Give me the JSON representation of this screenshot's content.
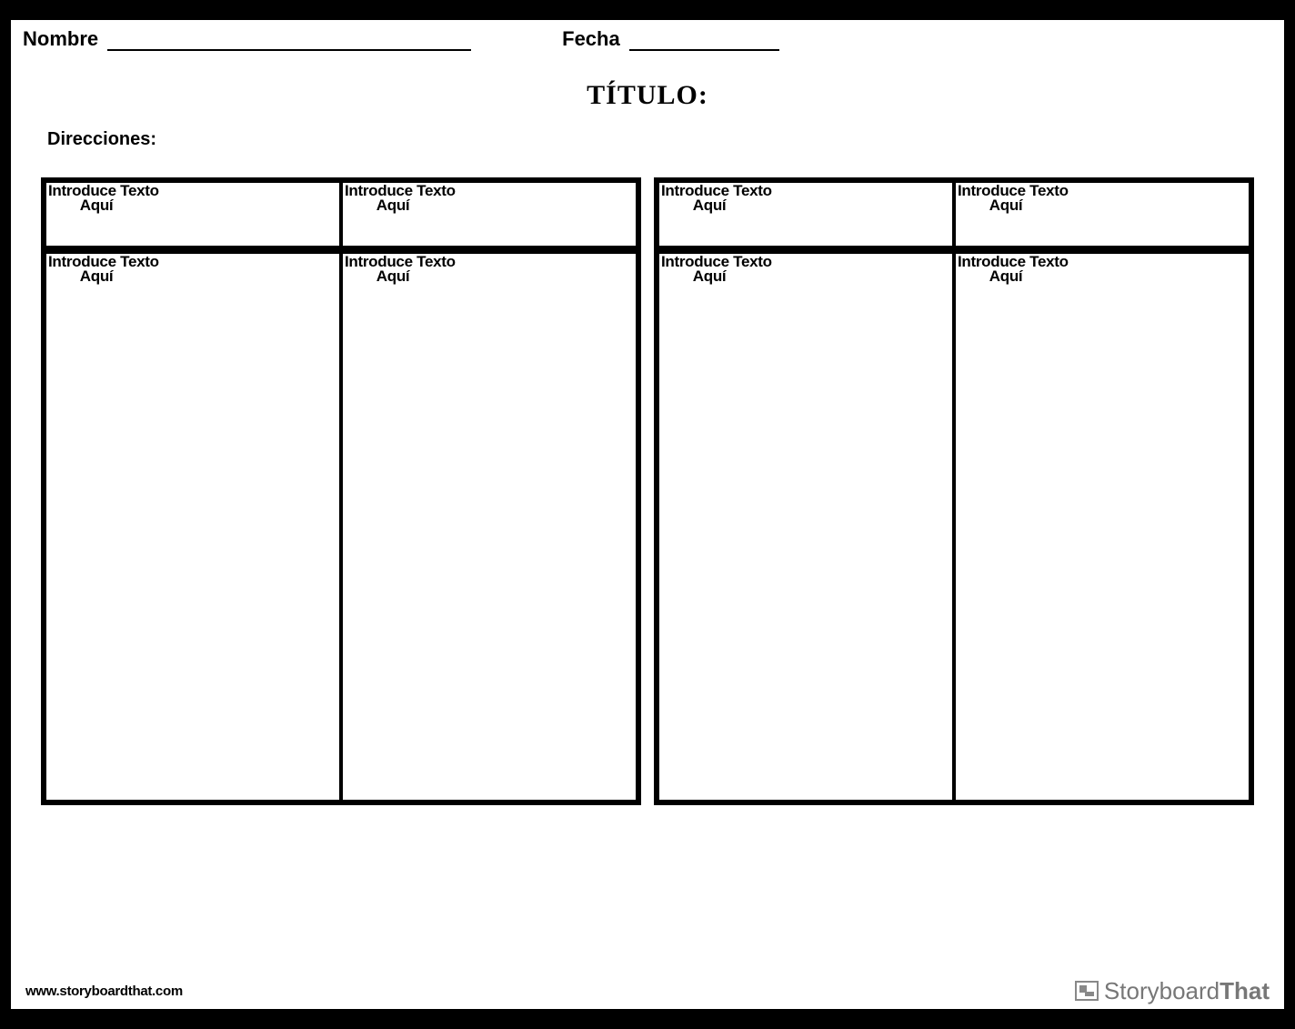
{
  "header": {
    "name_label": "Nombre",
    "date_label": "Fecha"
  },
  "title": "TÍTULO:",
  "directions_label": "Direcciones:",
  "cell_placeholder_line1": "Introduce Texto",
  "cell_placeholder_line2": "Aquí",
  "footer": {
    "url": "www.storyboardthat.com",
    "brand_thin": "Storyboard",
    "brand_bold": "That"
  }
}
